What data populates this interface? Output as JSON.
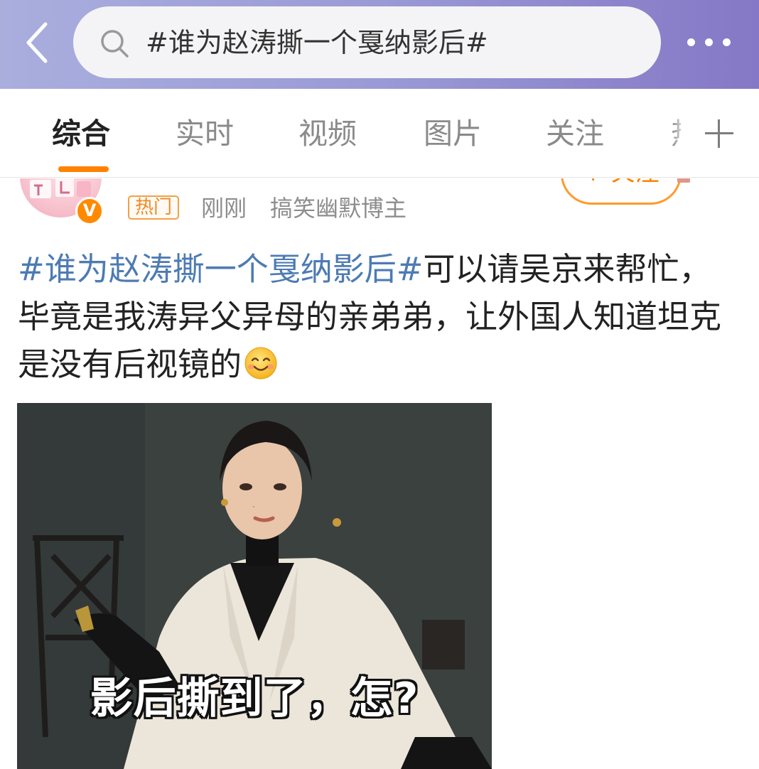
{
  "header": {
    "search_query": "#谁为赵涛撕一个戛纳影后#",
    "back_icon": "chevron-left-icon",
    "more_icon": "more-dots-icon",
    "gradient_colors": [
      "#a9aedd",
      "#8578c6"
    ]
  },
  "tabs": {
    "items": [
      {
        "label": "综合",
        "active": true
      },
      {
        "label": "实时",
        "active": false
      },
      {
        "label": "视频",
        "active": false
      },
      {
        "label": "图片",
        "active": false
      },
      {
        "label": "关注",
        "active": false
      }
    ],
    "cut_label": "热",
    "add_icon": "plus-icon",
    "accent_color": "#ff8200"
  },
  "post": {
    "hot_tag": "热门",
    "time": "刚刚",
    "author_desc": "搞笑幽默博主",
    "follow_label": "+ 关注",
    "verified_mark": "V",
    "hashtag": "#谁为赵涛撕一个戛纳影后#",
    "body": "可以请吴京来帮忙，毕竟是我涛异父异母的亲弟弟，让外国人知道坦克是没有后视镜的",
    "emoji": "smile-emoji",
    "image_caption": "影后撕到了，怎?"
  }
}
